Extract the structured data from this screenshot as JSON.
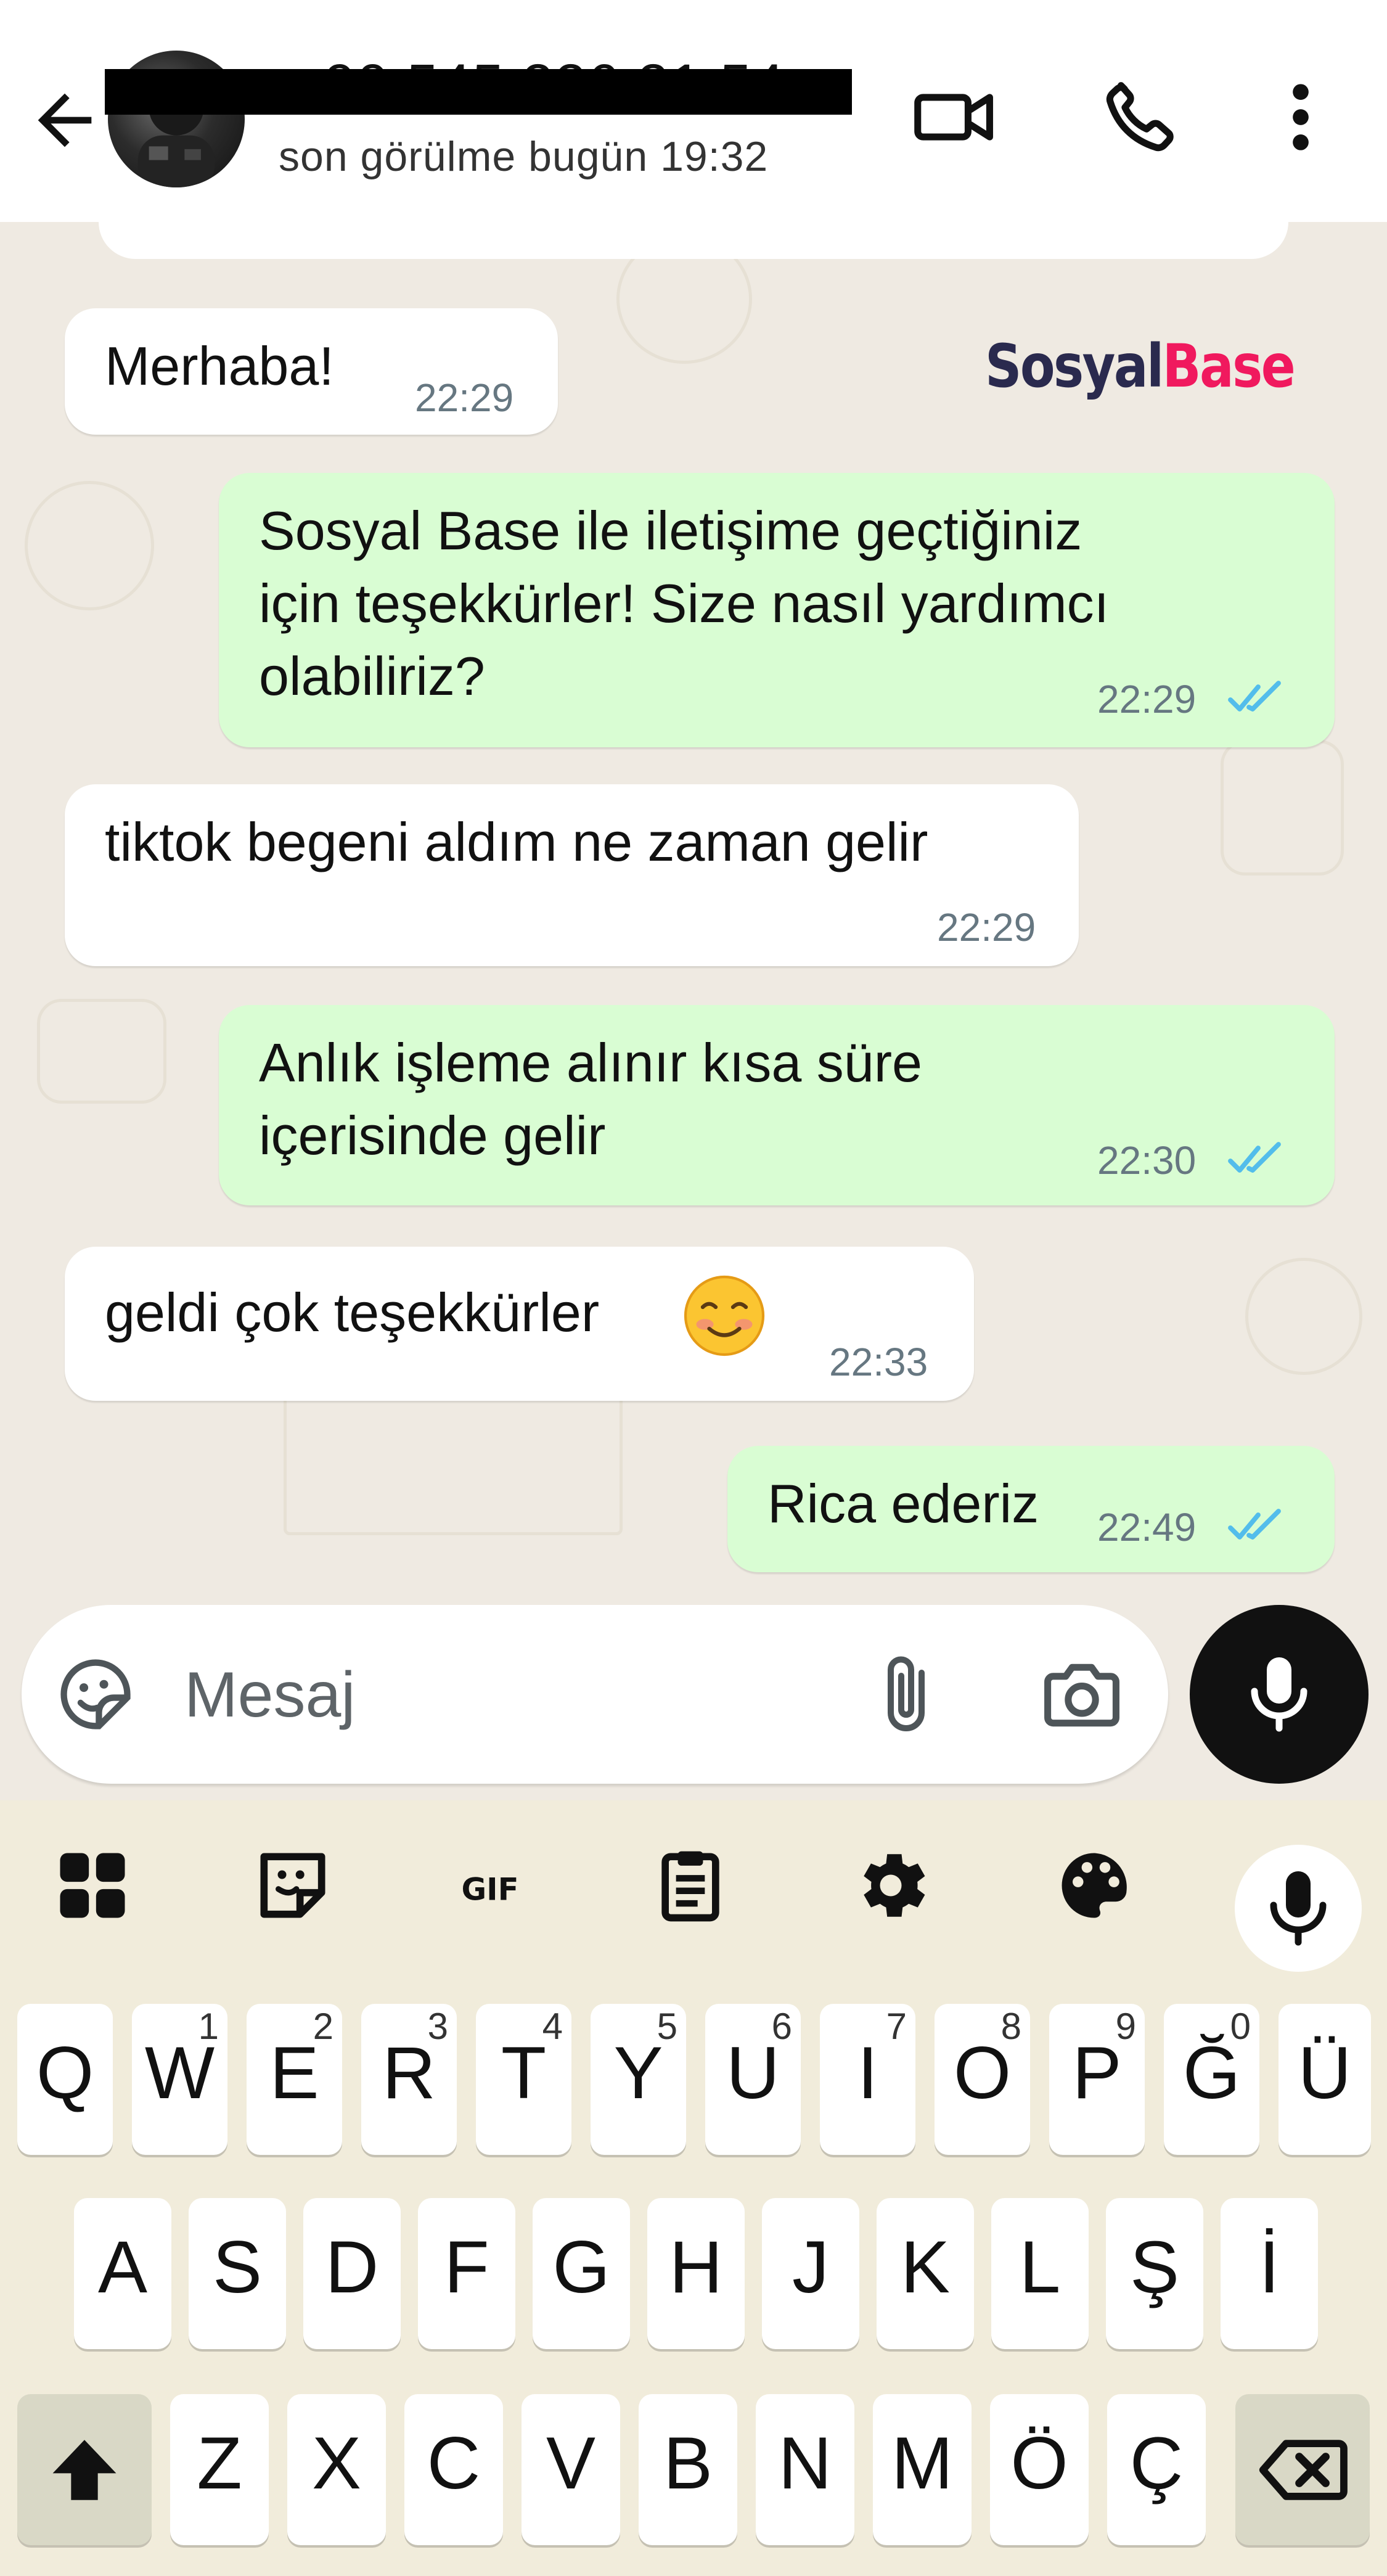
{
  "header": {
    "contact_name": "+90 545 226 21 54",
    "last_seen": "son görülme bugün 19:32",
    "icons": [
      "back-arrow-icon",
      "video-call-icon",
      "phone-icon",
      "more-vertical-icon"
    ]
  },
  "watermark": {
    "part1": "Sosyal",
    "part2": "Base"
  },
  "messages": [
    {
      "direction": "in",
      "lines": [
        "Merhaba!"
      ],
      "time": "22:29"
    },
    {
      "direction": "out",
      "lines": [
        "Sosyal Base ile iletişime geçtiğiniz",
        "için teşekkürler! Size nasıl yardımcı",
        "olabiliriz?"
      ],
      "time": "22:29",
      "status": "read"
    },
    {
      "direction": "in",
      "lines": [
        "tiktok begeni aldım ne zaman gelir"
      ],
      "time": "22:29"
    },
    {
      "direction": "out",
      "lines": [
        "Anlık işleme alınır kısa süre",
        "içerisinde gelir"
      ],
      "time": "22:30",
      "status": "read"
    },
    {
      "direction": "in",
      "lines": [
        "geldi çok teşekkürler"
      ],
      "emoji": "☺",
      "time": "22:33"
    },
    {
      "direction": "out",
      "lines": [
        "Rica ederiz"
      ],
      "time": "22:49",
      "status": "read"
    }
  ],
  "composer": {
    "placeholder": "Mesaj"
  },
  "keyboard": {
    "toolbar": [
      "apps-grid-icon",
      "sticker-icon",
      "GIF",
      "clipboard-icon",
      "settings-gear-icon",
      "theme-palette-icon",
      "microphone-icon"
    ],
    "row1": [
      {
        "k": "Q",
        "s": ""
      },
      {
        "k": "W",
        "s": "1"
      },
      {
        "k": "E",
        "s": "2"
      },
      {
        "k": "R",
        "s": "3"
      },
      {
        "k": "T",
        "s": "4"
      },
      {
        "k": "Y",
        "s": "5"
      },
      {
        "k": "U",
        "s": "6"
      },
      {
        "k": "I",
        "s": "7"
      },
      {
        "k": "O",
        "s": "8"
      },
      {
        "k": "P",
        "s": "9"
      },
      {
        "k": "Ğ",
        "s": "0"
      },
      {
        "k": "Ü",
        "s": ""
      }
    ],
    "row2": [
      "A",
      "S",
      "D",
      "F",
      "G",
      "H",
      "J",
      "K",
      "L",
      "Ş",
      "İ"
    ],
    "row3": [
      "Z",
      "X",
      "C",
      "V",
      "B",
      "N",
      "M",
      "Ö",
      "Ç"
    ],
    "shift_icon": "shift-arrow-icon",
    "backspace_icon": "backspace-icon"
  },
  "colors": {
    "chat_bg": "#efeae2",
    "outgoing_bubble": "#d9fdd3",
    "incoming_bubble": "#ffffff",
    "read_ticks": "#53bdeb",
    "mic_button": "#111111",
    "keyboard_bg": "#f1ecdb"
  }
}
